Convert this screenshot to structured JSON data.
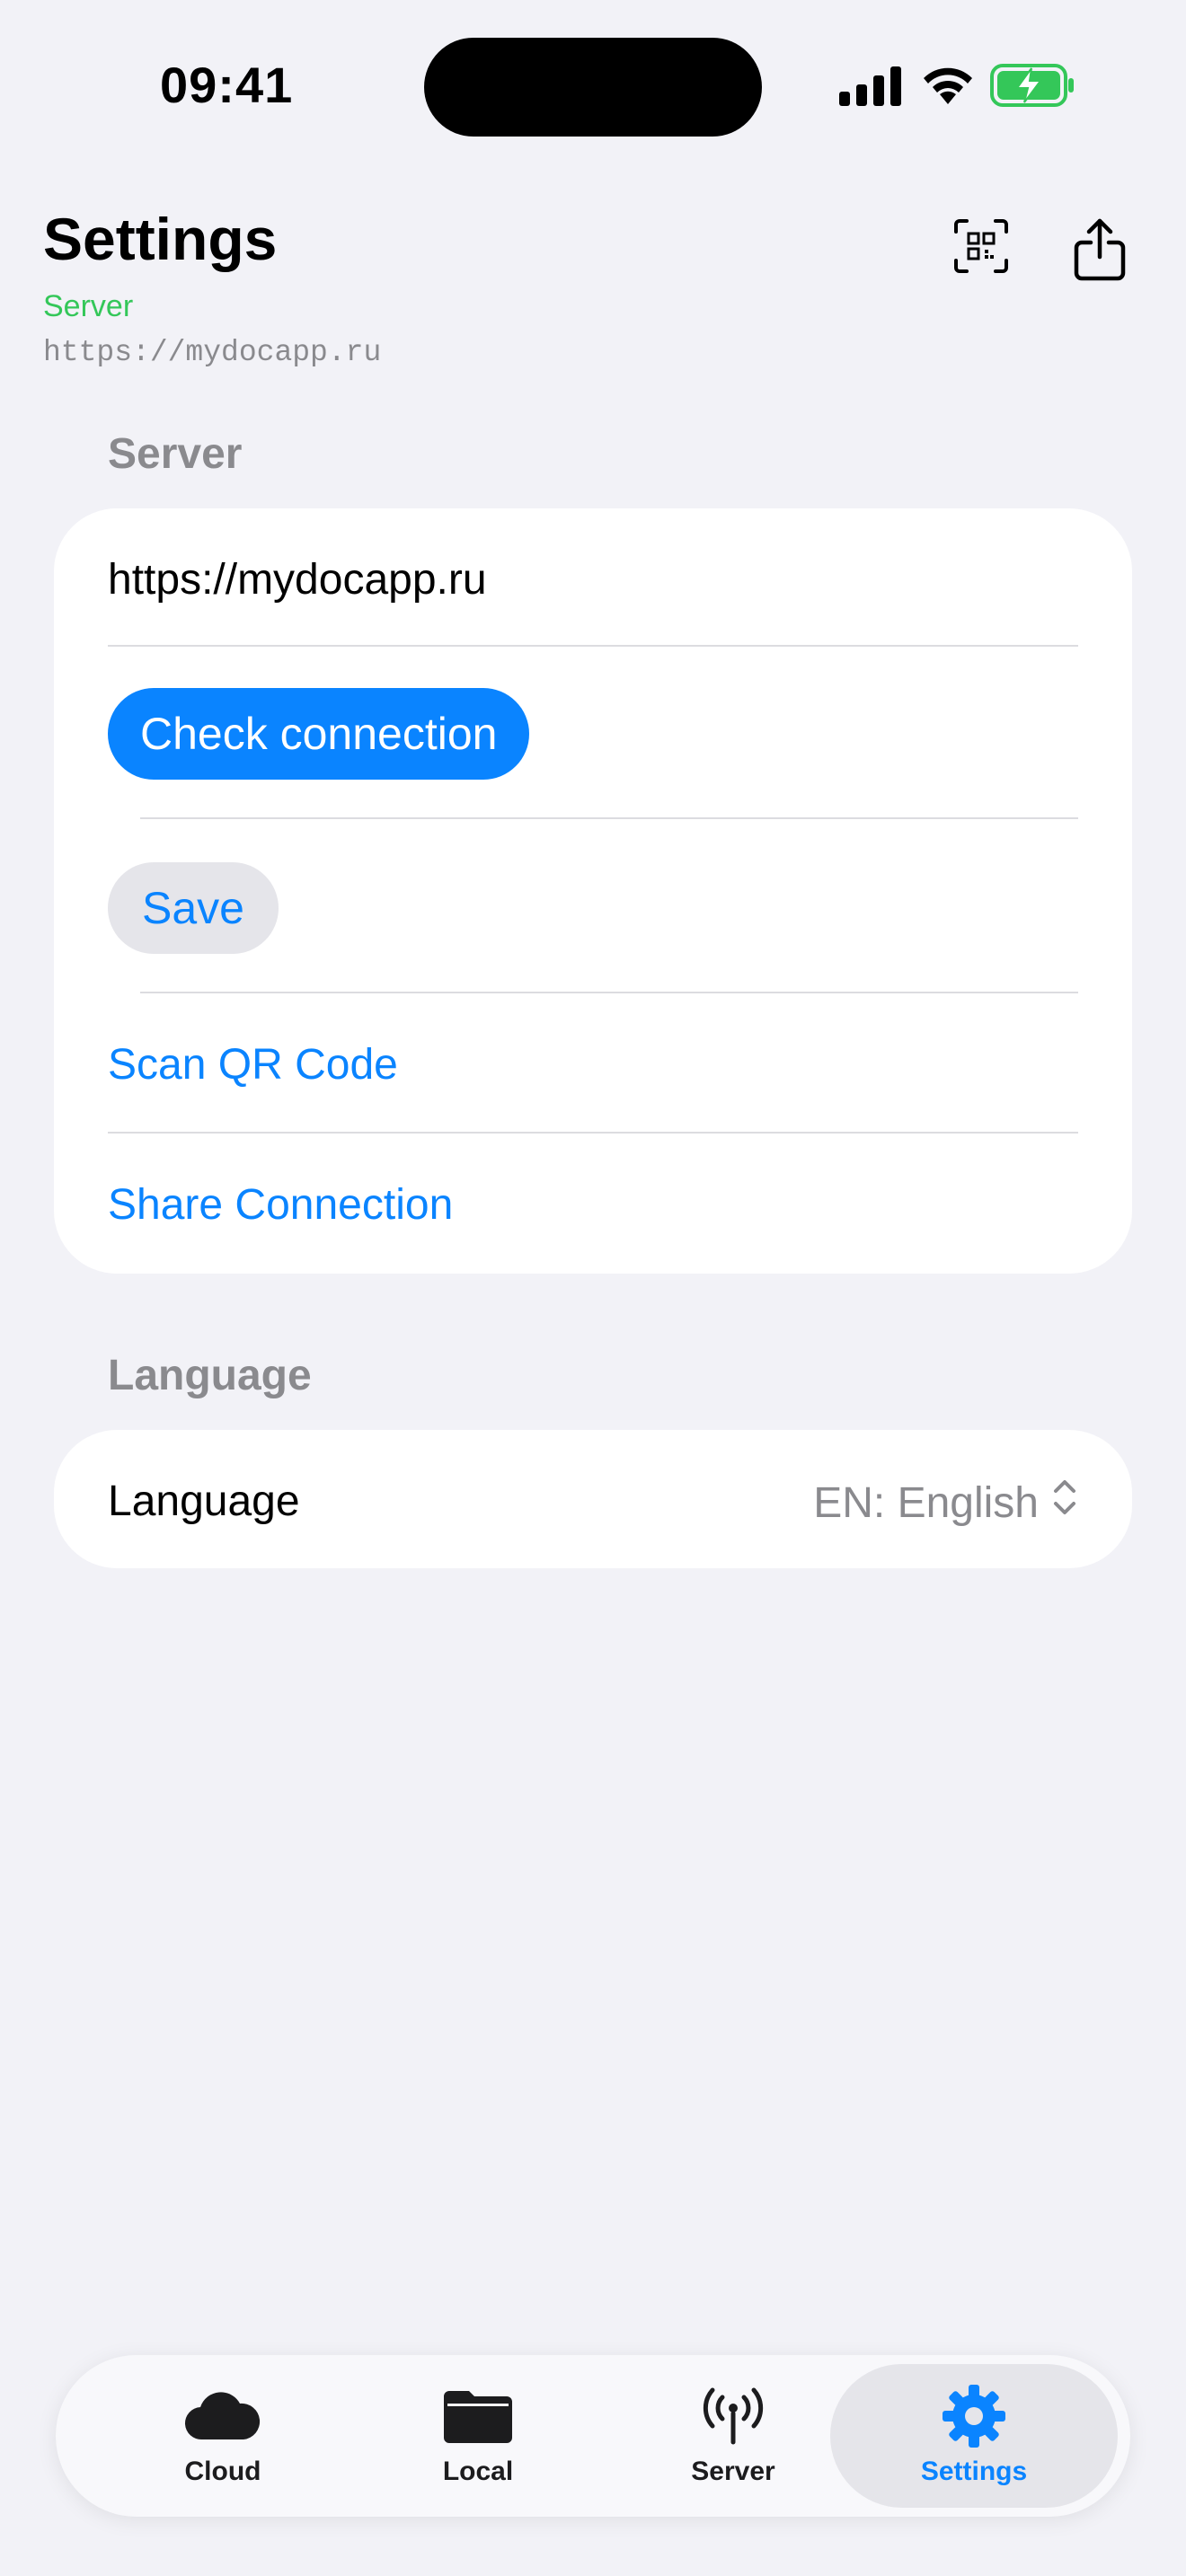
{
  "status_bar": {
    "time": "09:41",
    "icons": [
      "cellular-signal-icon",
      "wifi-icon",
      "battery-charging-icon"
    ]
  },
  "header": {
    "title": "Settings",
    "connection_status": "Server",
    "connection_url": "https://mydocapp.ru",
    "buttons": [
      "qr-code-icon",
      "share-icon"
    ]
  },
  "server_section": {
    "header": "Server",
    "url_value": "https://mydocapp.ru",
    "check_connection_label": "Check connection",
    "save_label": "Save",
    "scan_qr_label": "Scan QR Code",
    "share_connection_label": "Share Connection"
  },
  "language_section": {
    "header": "Language",
    "row_label": "Language",
    "selected_value": "EN: English"
  },
  "tab_bar": {
    "tabs": [
      {
        "label": "Cloud",
        "icon": "cloud-icon"
      },
      {
        "label": "Local",
        "icon": "folder-icon"
      },
      {
        "label": "Server",
        "icon": "antenna-icon"
      },
      {
        "label": "Settings",
        "icon": "gear-icon"
      }
    ],
    "active_tab": "Settings"
  },
  "colors": {
    "accent": "#0a84ff",
    "status_green": "#34c759",
    "background": "#f2f2f7",
    "secondary_text": "#8a8a8e"
  }
}
